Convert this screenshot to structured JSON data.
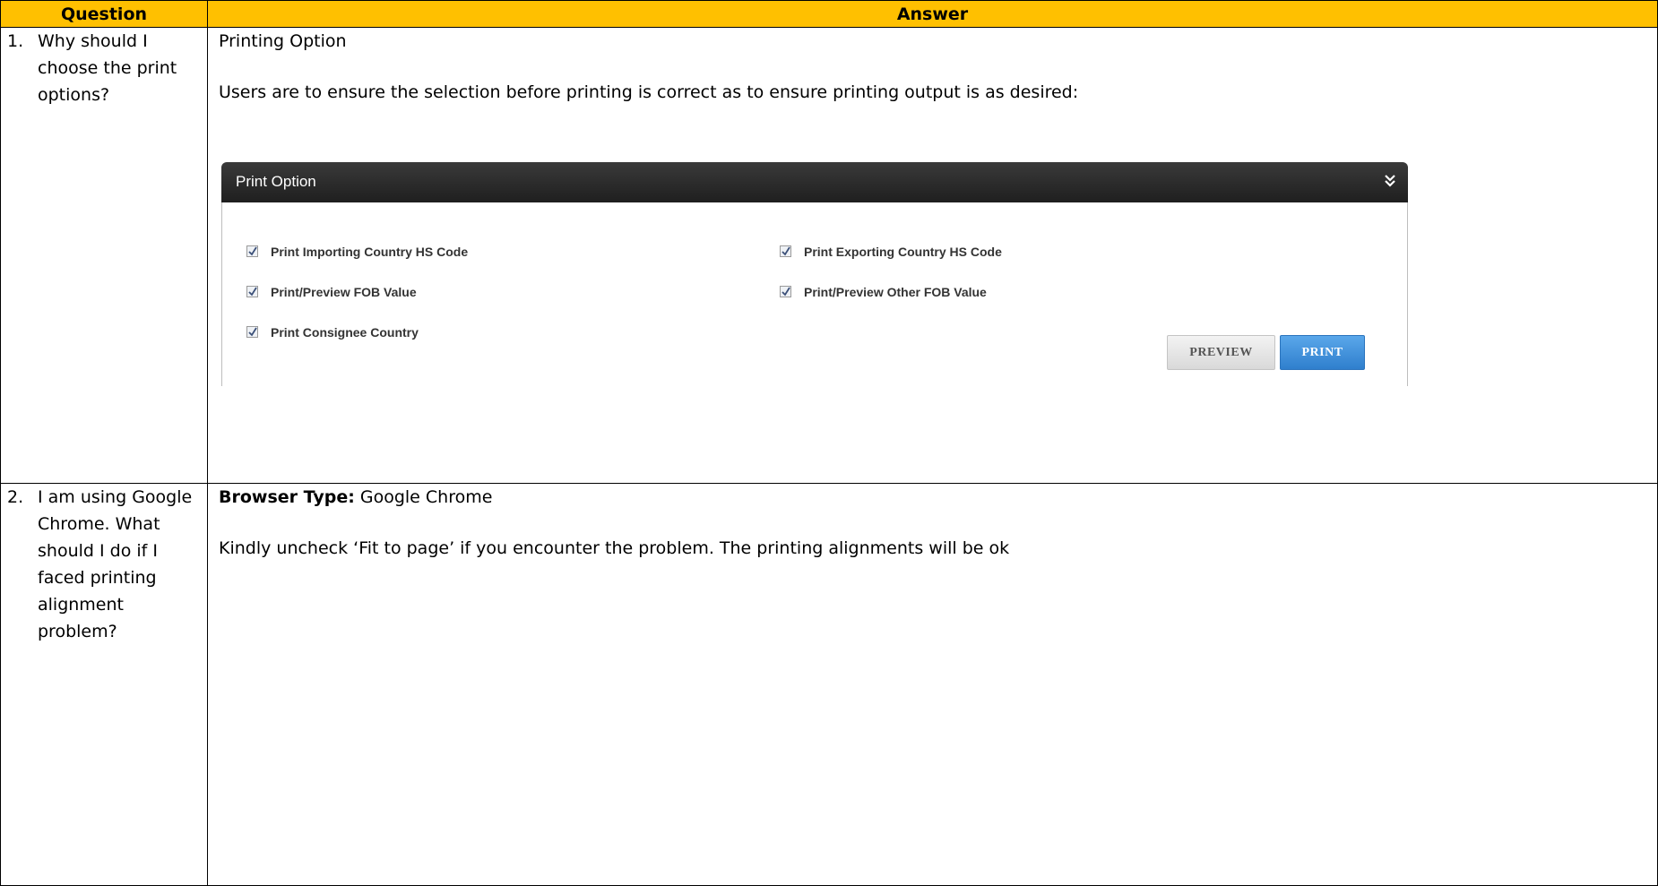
{
  "table": {
    "headers": {
      "question": "Question",
      "answer": "Answer"
    },
    "rows": [
      {
        "num": "1.",
        "question": "Why should I choose the print options?",
        "answer_title": "Printing Option",
        "answer_text": "Users are to ensure the selection before printing is correct as to ensure printing output is as desired:"
      },
      {
        "num": "2.",
        "question": "I am using Google Chrome. What should I do if I faced printing alignment problem?",
        "answer_label": "Browser Type:",
        "answer_value": " Google Chrome",
        "answer_text": "Kindly uncheck ‘Fit to page’ if you encounter the problem. The printing alignments will be ok"
      }
    ]
  },
  "print_panel": {
    "title": "Print Option",
    "options": [
      {
        "label": "Print Importing Country HS Code",
        "checked": true
      },
      {
        "label": "Print Exporting Country HS Code",
        "checked": true
      },
      {
        "label": "Print/Preview FOB Value",
        "checked": true
      },
      {
        "label": "Print/Preview Other FOB Value",
        "checked": true
      },
      {
        "label": "Print Consignee Country",
        "checked": true
      }
    ],
    "preview_button": "PREVIEW",
    "print_button": "PRINT",
    "colors": {
      "header": "#2a2a2a",
      "print_button": "#3f8fdc",
      "table_header": "#ffc000"
    }
  }
}
